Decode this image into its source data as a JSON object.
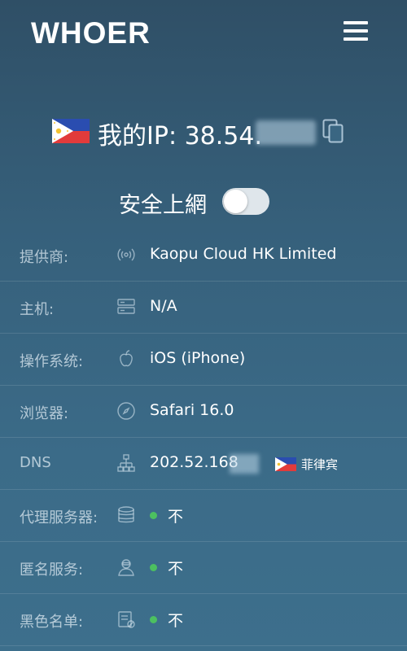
{
  "header": {
    "logo": "WHOER",
    "menu_icon": "hamburger-menu-icon"
  },
  "ip": {
    "prefix": "我的IP: 38.54.",
    "suffix": "",
    "copy_icon": "copy-icon",
    "flag": "philippines-flag"
  },
  "secure": {
    "label": "安全上網",
    "enabled": false
  },
  "rows": [
    {
      "label": "提供商:",
      "icon": "signal-icon",
      "value": "Kaopu Cloud HK Limited"
    },
    {
      "label": "主机:",
      "icon": "server-icon",
      "value": "N/A"
    },
    {
      "label": "操作系统:",
      "icon": "apple-icon",
      "value": "iOS (iPhone)"
    },
    {
      "label": "浏览器:",
      "icon": "compass-icon",
      "value": "Safari 16.0"
    },
    {
      "label": "DNS",
      "icon": "network-icon",
      "value": "202.52.168",
      "country": "菲律宾"
    },
    {
      "label": "代理服务器:",
      "icon": "database-icon",
      "value": "不",
      "status_color": "#4cc060"
    },
    {
      "label": "匿名服务:",
      "icon": "anonymous-icon",
      "value": "不",
      "status_color": "#4cc060"
    },
    {
      "label": "黑色名单:",
      "icon": "blacklist-icon",
      "value": "不",
      "status_color": "#4cc060"
    }
  ]
}
